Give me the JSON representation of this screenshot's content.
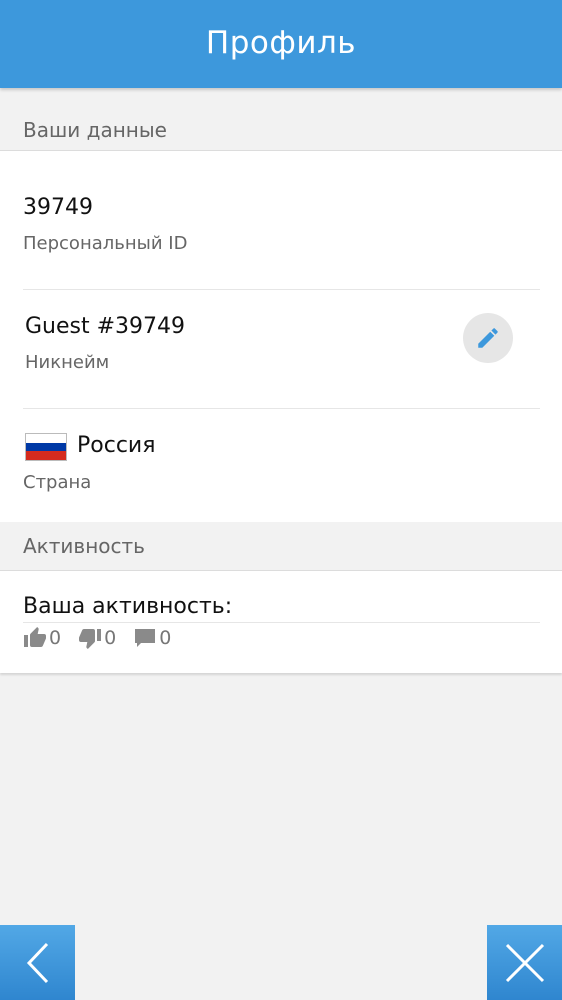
{
  "header": {
    "title": "Профиль"
  },
  "sections": {
    "your_data": {
      "title": "Ваши данные"
    },
    "activity": {
      "title": "Активность"
    }
  },
  "profile": {
    "id": {
      "value": "39749",
      "label": "Персональный ID"
    },
    "nickname": {
      "value": "Guest #39749",
      "label": "Никнейм"
    },
    "country": {
      "value": "Россия",
      "label": "Страна",
      "flag": "russia-flag"
    }
  },
  "activity": {
    "title": "Ваша активность:",
    "likes": "0",
    "dislikes": "0",
    "comments": "0"
  },
  "nav": {
    "back_icon": "chevron-left-icon",
    "close_icon": "close-icon"
  },
  "colors": {
    "accent": "#3d98dc",
    "background": "#f2f2f2",
    "card": "#ffffff",
    "flag_white": "#ffffff",
    "flag_blue": "#0039a6",
    "flag_red": "#d52b1e"
  }
}
